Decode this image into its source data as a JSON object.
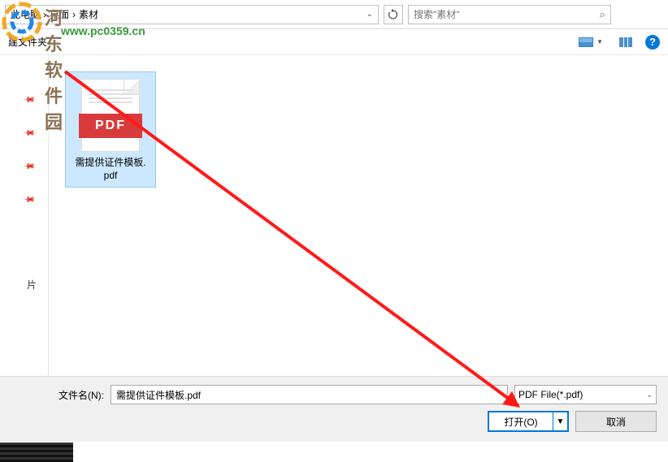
{
  "watermark": {
    "title": "河东软件园",
    "url": "www.pc0359.cn"
  },
  "topbar": {
    "breadcrumb": {
      "segments": [
        "此电脑",
        "桌面",
        "素材"
      ]
    },
    "search_placeholder": "搜索\"素材\""
  },
  "actionbar": {
    "new_folder_label": "建文件夹"
  },
  "sidebar": {
    "pins": [
      "",
      "",
      "",
      ""
    ],
    "photo_label": "片"
  },
  "files": {
    "selected": {
      "badge": "PDF",
      "name_line1": "需提供证件模板.",
      "name_line2": "pdf"
    }
  },
  "bottom": {
    "filename_label": "文件名(N):",
    "filename_value": "需提供证件模板.pdf",
    "filetype_value": "PDF File(*.pdf)",
    "open_label": "打开(O)",
    "cancel_label": "取消"
  }
}
